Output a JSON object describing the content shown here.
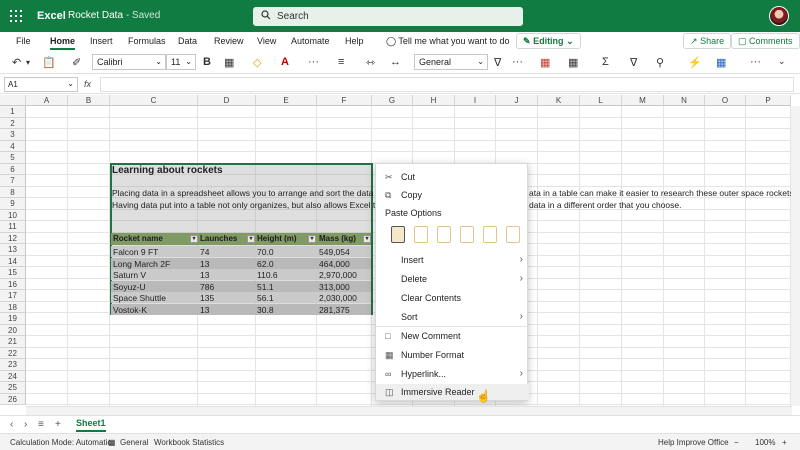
{
  "app": {
    "name": "Excel",
    "doc_title": "Rocket Data",
    "doc_status": "- Saved",
    "search_label": "Search"
  },
  "ribbon": {
    "tabs": [
      "File",
      "Home",
      "Insert",
      "Formulas",
      "Data",
      "Review",
      "View",
      "Automate",
      "Help"
    ],
    "active_tab": "Home",
    "tell_me": "Tell me what you want to do",
    "editing": "Editing",
    "share": "Share",
    "comments": "Comments"
  },
  "toolbar": {
    "font": "Calibri",
    "size": "11",
    "format": "General"
  },
  "formula_bar": {
    "name_box": "A1",
    "fx": "fx"
  },
  "columns": [
    "A",
    "B",
    "C",
    "D",
    "E",
    "F",
    "G",
    "H",
    "I",
    "J",
    "K",
    "L",
    "M",
    "N",
    "O",
    "P"
  ],
  "rows": [
    "1",
    "2",
    "3",
    "4",
    "5",
    "6",
    "7",
    "8",
    "9",
    "10",
    "11",
    "12",
    "13",
    "14",
    "15",
    "16",
    "17",
    "18",
    "19",
    "20",
    "21",
    "22",
    "23",
    "24",
    "25",
    "26"
  ],
  "sheet": {
    "title": "Learning about rockets",
    "para1a": "Placing data in a spreadsheet allows you to arrange and sort the data to get i",
    "para1b": "ata in a table can make it easier to research these outer space rockets!",
    "para2a": "Having data put into a table not only organizes, but also allows Excel to sort f",
    "para2b": "data in a different order that you choose.",
    "headers": [
      "Rocket name",
      "Launches",
      "Height (m)",
      "Mass (kg)"
    ],
    "rows": [
      [
        "Falcon 9 FT",
        "74",
        "70.0",
        "549,054"
      ],
      [
        "Long March 2F",
        "13",
        "62.0",
        "464,000"
      ],
      [
        "Saturn V",
        "13",
        "110.6",
        "2,970,000"
      ],
      [
        "Soyuz-U",
        "786",
        "51.1",
        "313,000"
      ],
      [
        "Space Shuttle",
        "135",
        "56.1",
        "2,030,000"
      ],
      [
        "Vostok-K",
        "13",
        "30.8",
        "281,375"
      ]
    ]
  },
  "context_menu": {
    "cut": "Cut",
    "copy": "Copy",
    "paste_options": "Paste Options",
    "insert": "Insert",
    "delete": "Delete",
    "clear_contents": "Clear Contents",
    "sort": "Sort",
    "new_comment": "New Comment",
    "number_format": "Number Format",
    "hyperlink": "Hyperlink...",
    "immersive_reader": "Immersive Reader"
  },
  "sheet_tab": "Sheet1",
  "status": {
    "calc_mode": "Calculation Mode: Automatic",
    "general": "General",
    "workbook_stats": "Workbook Statistics",
    "help_improve": "Help Improve Office",
    "zoom": "100%"
  }
}
